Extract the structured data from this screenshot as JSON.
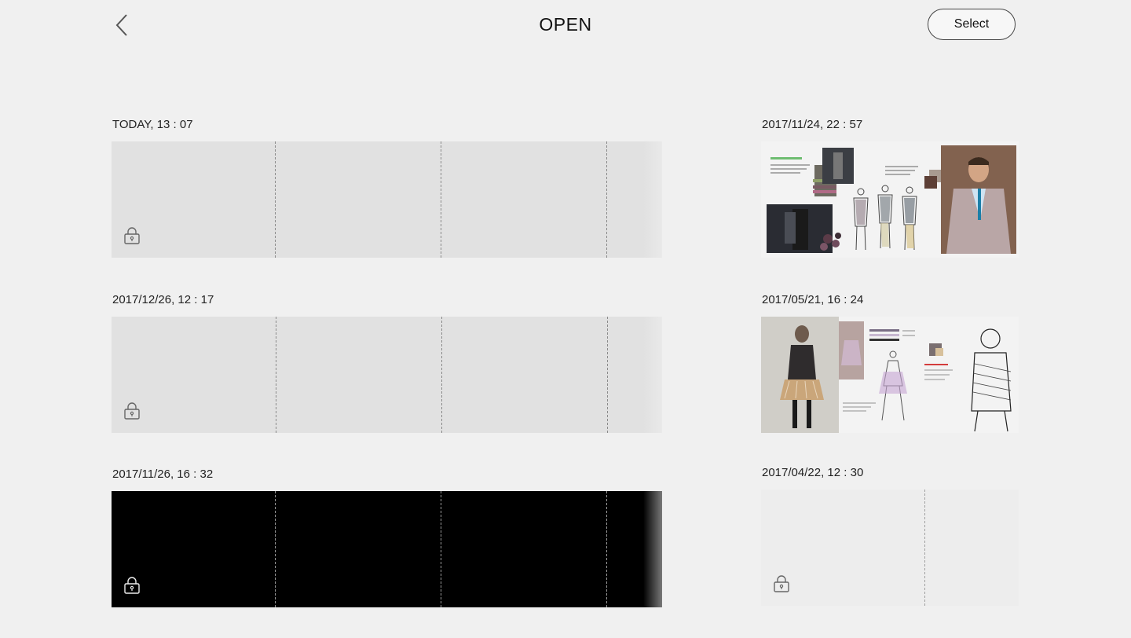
{
  "header": {
    "title": "OPEN",
    "select_label": "Select"
  },
  "notes_left": [
    {
      "date": "TODAY, 13 : 07",
      "style": "light",
      "locked": true
    },
    {
      "date": "2017/12/26, 12 : 17",
      "style": "light",
      "locked": true
    },
    {
      "date": "2017/11/26, 16 : 32",
      "style": "dark",
      "locked": true
    }
  ],
  "notes_right": [
    {
      "date": "2017/11/24, 22 : 57",
      "content": "menswear moodboard"
    },
    {
      "date": "2017/05/21, 16 : 24",
      "content": "womenswear sketches"
    },
    {
      "date": "2017/04/22, 12 : 30",
      "style": "blank",
      "locked": true
    }
  ],
  "colors": {
    "background": "#f0f0f0",
    "light_page": "#e1e1e1",
    "dark_page": "#000000",
    "blank_page": "#ededed"
  },
  "icons": {
    "back": "chevron-left-icon",
    "lock": "lock-icon"
  }
}
